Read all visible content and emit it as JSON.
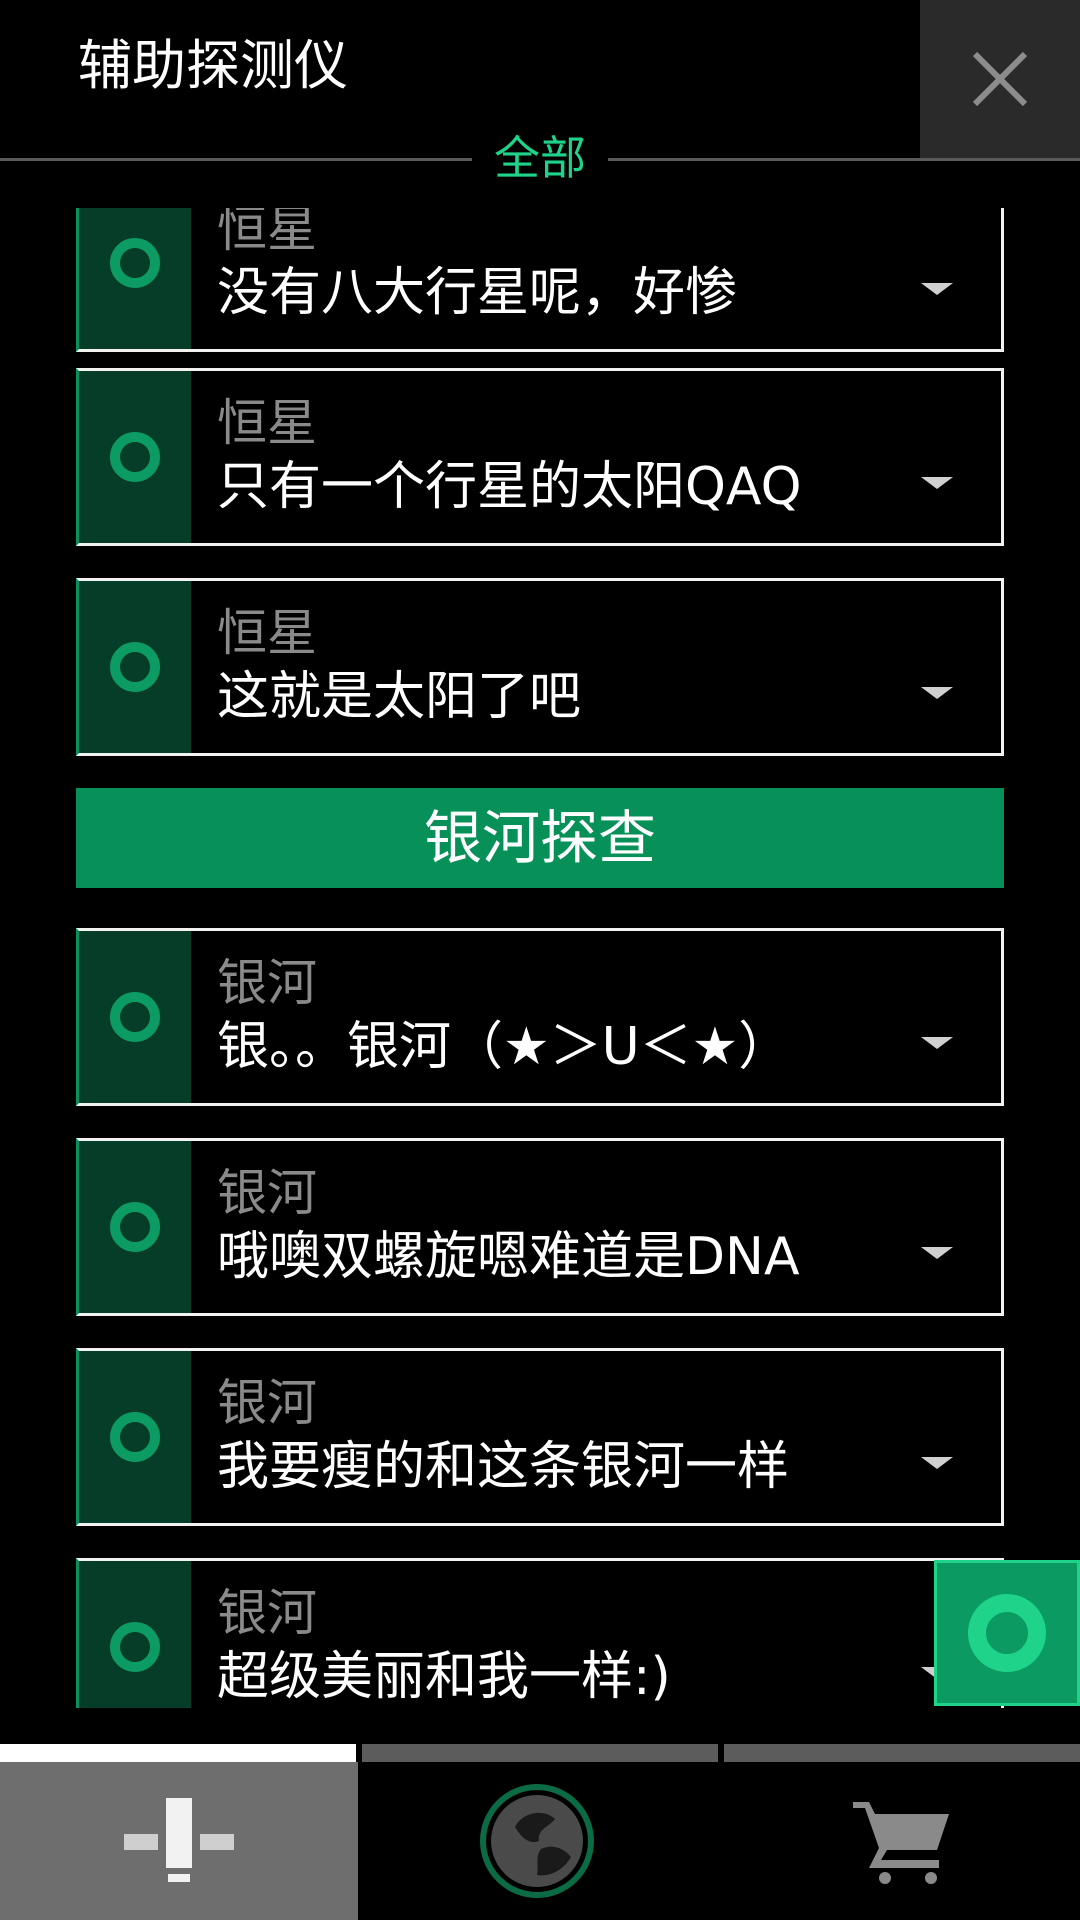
{
  "header": {
    "title": "辅助探测仪",
    "filter_label": "全部"
  },
  "list": {
    "star_items": [
      {
        "category": "恒星",
        "text": "没有八大行星呢，好惨"
      },
      {
        "category": "恒星",
        "text": "只有一个行星的太阳QAQ"
      },
      {
        "category": "恒星",
        "text": "这就是太阳了吧"
      }
    ],
    "section_button_label": "银河探查",
    "galaxy_items": [
      {
        "category": "银河",
        "text": "银。。银河（★＞U＜★）"
      },
      {
        "category": "银河",
        "text": "哦噢双螺旋嗯难道是DNA"
      },
      {
        "category": "银河",
        "text": "我要瘦的和这条银河一样"
      },
      {
        "category": "银河",
        "text": "超级美丽和我一样:)"
      }
    ]
  },
  "icons": {
    "close": "close-icon",
    "item": "ring-icon",
    "fab": "ring-icon",
    "tabs": [
      "satellite-icon",
      "planet-icon",
      "cart-icon"
    ]
  },
  "colors": {
    "accent": "#1fd38a",
    "accent_dark": "#079159",
    "icon_column": "#063d28"
  },
  "nav": {
    "active_index": 0
  }
}
